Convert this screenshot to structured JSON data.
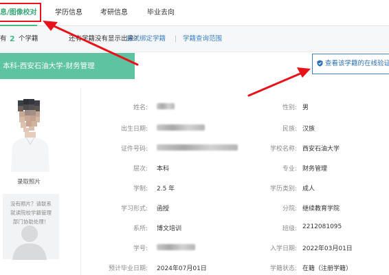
{
  "nav": {
    "tabs": [
      {
        "label": "息/图像校对",
        "active": true
      },
      {
        "label": "学历信息"
      },
      {
        "label": "考研信息"
      },
      {
        "label": "毕业去向"
      }
    ]
  },
  "count_bar": {
    "prefix": "有",
    "count": "2",
    "unit": "个学籍",
    "question": "还有学籍没有显示出来?",
    "bind_link": "尝试绑定学籍",
    "divider": "|",
    "scope_link": "学籍查询范围"
  },
  "record": {
    "header": "本科-西安石油大学-财务管理",
    "verify_button": "查看该学籍的在线验证"
  },
  "photo": {
    "caption": "录取照片",
    "no_photo_text": [
      "没有照片？请联系",
      "就读院校学籍管理",
      "部门协助处理！"
    ]
  },
  "fields": {
    "name_label": "姓名:",
    "gender_label": "性别:",
    "gender": "男",
    "birth_label": "出生日期:",
    "ethnicity_label": "民族:",
    "ethnicity": "汉族",
    "id_label": "证件号码:",
    "school_label": "学校名称:",
    "school": "西安石油大学",
    "level_label": "层次:",
    "level": "本科",
    "major_label": "专业:",
    "major": "财务管理",
    "duration_label": "学制:",
    "duration": "2.5 年",
    "category_label": "学历类别:",
    "category": "成人",
    "form_label": "学习形式:",
    "form": "函授",
    "branch_label": "分院:",
    "branch": "继续教育学院",
    "dept_label": "系所:",
    "dept": "博文培训",
    "class_label": "班级:",
    "class_no": "2212081095",
    "student_no_label": "学号:",
    "enroll_label": "入学日期:",
    "enroll_date": "2022年03月01日",
    "grad_label": "预计毕业日期:",
    "grad_date": "2024年07月01日",
    "status_label": "学籍状态:",
    "status": "在籍（注册学籍）"
  },
  "colors": {
    "accent_green": "#45b883",
    "header_green": "#5dc3a0",
    "link_blue": "#3d82c4",
    "highlight_red": "#e8131a"
  }
}
